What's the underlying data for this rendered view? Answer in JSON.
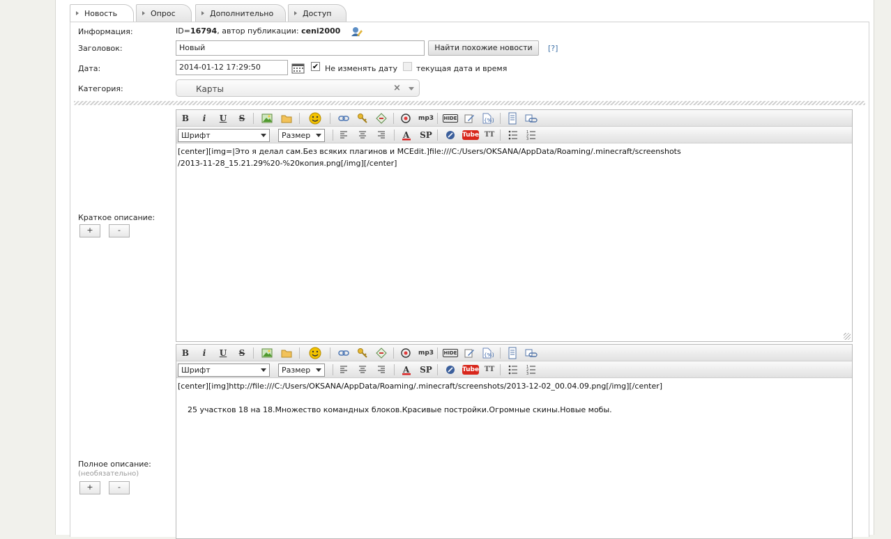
{
  "tabs": [
    {
      "label": "Новость"
    },
    {
      "label": "Опрос"
    },
    {
      "label": "Дополнительно"
    },
    {
      "label": "Доступ"
    }
  ],
  "info": {
    "label": "Информация:",
    "id_prefix": "ID=",
    "id_value": "16794",
    "author_prefix": ", автор публикации: ",
    "author": "ceni2000"
  },
  "title_row": {
    "label": "Заголовок:",
    "value": "Новый",
    "find_button": "Найти похожие новости",
    "help_link": "[?]"
  },
  "date_row": {
    "label": "Дата:",
    "value": "2014-01-12 17:29:50",
    "keep_date_checked": true,
    "keep_date_label": "Не изменять дату",
    "current_date_checked": false,
    "current_date_label": "текущая дата и время"
  },
  "category_row": {
    "label": "Категория:",
    "value": "Карты",
    "clear": "×"
  },
  "toolbar": {
    "bold": "B",
    "italic": "i",
    "underline": "U",
    "strike": "S",
    "mp3": "mp3",
    "hide": "HIDE",
    "font_select": "Шрифт",
    "size_select": "Размер",
    "sp": "SP",
    "youtube": "Tube",
    "tt": "TT"
  },
  "short_desc": {
    "label": "Краткое описание:",
    "text": "[center][img=|Это я делал сам.Без всяких плагинов и MCEdit.]file:///C:/Users/OKSANA/AppData/Roaming/.minecraft/screenshots\n/2013-11-28_15.21.29%20-%20копия.png[/img][/center]",
    "plus": "+",
    "minus": "-"
  },
  "full_desc": {
    "label": "Полное описание:",
    "note": "(необязательно)",
    "text": "[center][img]http://file:///C:/Users/OKSANA/AppData/Roaming/.minecraft/screenshots/2013-12-02_00.04.09.png[/img][/center]\n\n    25 участков 18 на 18.Множество командных блоков.Красивые постройки.Огромные скины.Новые мобы.",
    "plus": "+",
    "minus": "-"
  },
  "colors": {
    "link": "#3a6ea5",
    "youtube": "#d8261b",
    "smiley": "#f2c200"
  }
}
